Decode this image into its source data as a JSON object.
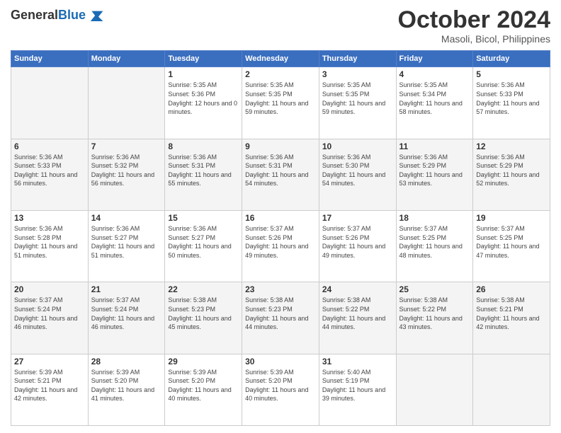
{
  "logo": {
    "general": "General",
    "blue": "Blue"
  },
  "header": {
    "month": "October 2024",
    "location": "Masoli, Bicol, Philippines"
  },
  "weekdays": [
    "Sunday",
    "Monday",
    "Tuesday",
    "Wednesday",
    "Thursday",
    "Friday",
    "Saturday"
  ],
  "weeks": [
    [
      {
        "day": "",
        "sunrise": "",
        "sunset": "",
        "daylight": ""
      },
      {
        "day": "",
        "sunrise": "",
        "sunset": "",
        "daylight": ""
      },
      {
        "day": "1",
        "sunrise": "Sunrise: 5:35 AM",
        "sunset": "Sunset: 5:36 PM",
        "daylight": "Daylight: 12 hours and 0 minutes."
      },
      {
        "day": "2",
        "sunrise": "Sunrise: 5:35 AM",
        "sunset": "Sunset: 5:35 PM",
        "daylight": "Daylight: 11 hours and 59 minutes."
      },
      {
        "day": "3",
        "sunrise": "Sunrise: 5:35 AM",
        "sunset": "Sunset: 5:35 PM",
        "daylight": "Daylight: 11 hours and 59 minutes."
      },
      {
        "day": "4",
        "sunrise": "Sunrise: 5:35 AM",
        "sunset": "Sunset: 5:34 PM",
        "daylight": "Daylight: 11 hours and 58 minutes."
      },
      {
        "day": "5",
        "sunrise": "Sunrise: 5:36 AM",
        "sunset": "Sunset: 5:33 PM",
        "daylight": "Daylight: 11 hours and 57 minutes."
      }
    ],
    [
      {
        "day": "6",
        "sunrise": "Sunrise: 5:36 AM",
        "sunset": "Sunset: 5:33 PM",
        "daylight": "Daylight: 11 hours and 56 minutes."
      },
      {
        "day": "7",
        "sunrise": "Sunrise: 5:36 AM",
        "sunset": "Sunset: 5:32 PM",
        "daylight": "Daylight: 11 hours and 56 minutes."
      },
      {
        "day": "8",
        "sunrise": "Sunrise: 5:36 AM",
        "sunset": "Sunset: 5:31 PM",
        "daylight": "Daylight: 11 hours and 55 minutes."
      },
      {
        "day": "9",
        "sunrise": "Sunrise: 5:36 AM",
        "sunset": "Sunset: 5:31 PM",
        "daylight": "Daylight: 11 hours and 54 minutes."
      },
      {
        "day": "10",
        "sunrise": "Sunrise: 5:36 AM",
        "sunset": "Sunset: 5:30 PM",
        "daylight": "Daylight: 11 hours and 54 minutes."
      },
      {
        "day": "11",
        "sunrise": "Sunrise: 5:36 AM",
        "sunset": "Sunset: 5:29 PM",
        "daylight": "Daylight: 11 hours and 53 minutes."
      },
      {
        "day": "12",
        "sunrise": "Sunrise: 5:36 AM",
        "sunset": "Sunset: 5:29 PM",
        "daylight": "Daylight: 11 hours and 52 minutes."
      }
    ],
    [
      {
        "day": "13",
        "sunrise": "Sunrise: 5:36 AM",
        "sunset": "Sunset: 5:28 PM",
        "daylight": "Daylight: 11 hours and 51 minutes."
      },
      {
        "day": "14",
        "sunrise": "Sunrise: 5:36 AM",
        "sunset": "Sunset: 5:27 PM",
        "daylight": "Daylight: 11 hours and 51 minutes."
      },
      {
        "day": "15",
        "sunrise": "Sunrise: 5:36 AM",
        "sunset": "Sunset: 5:27 PM",
        "daylight": "Daylight: 11 hours and 50 minutes."
      },
      {
        "day": "16",
        "sunrise": "Sunrise: 5:37 AM",
        "sunset": "Sunset: 5:26 PM",
        "daylight": "Daylight: 11 hours and 49 minutes."
      },
      {
        "day": "17",
        "sunrise": "Sunrise: 5:37 AM",
        "sunset": "Sunset: 5:26 PM",
        "daylight": "Daylight: 11 hours and 49 minutes."
      },
      {
        "day": "18",
        "sunrise": "Sunrise: 5:37 AM",
        "sunset": "Sunset: 5:25 PM",
        "daylight": "Daylight: 11 hours and 48 minutes."
      },
      {
        "day": "19",
        "sunrise": "Sunrise: 5:37 AM",
        "sunset": "Sunset: 5:25 PM",
        "daylight": "Daylight: 11 hours and 47 minutes."
      }
    ],
    [
      {
        "day": "20",
        "sunrise": "Sunrise: 5:37 AM",
        "sunset": "Sunset: 5:24 PM",
        "daylight": "Daylight: 11 hours and 46 minutes."
      },
      {
        "day": "21",
        "sunrise": "Sunrise: 5:37 AM",
        "sunset": "Sunset: 5:24 PM",
        "daylight": "Daylight: 11 hours and 46 minutes."
      },
      {
        "day": "22",
        "sunrise": "Sunrise: 5:38 AM",
        "sunset": "Sunset: 5:23 PM",
        "daylight": "Daylight: 11 hours and 45 minutes."
      },
      {
        "day": "23",
        "sunrise": "Sunrise: 5:38 AM",
        "sunset": "Sunset: 5:23 PM",
        "daylight": "Daylight: 11 hours and 44 minutes."
      },
      {
        "day": "24",
        "sunrise": "Sunrise: 5:38 AM",
        "sunset": "Sunset: 5:22 PM",
        "daylight": "Daylight: 11 hours and 44 minutes."
      },
      {
        "day": "25",
        "sunrise": "Sunrise: 5:38 AM",
        "sunset": "Sunset: 5:22 PM",
        "daylight": "Daylight: 11 hours and 43 minutes."
      },
      {
        "day": "26",
        "sunrise": "Sunrise: 5:38 AM",
        "sunset": "Sunset: 5:21 PM",
        "daylight": "Daylight: 11 hours and 42 minutes."
      }
    ],
    [
      {
        "day": "27",
        "sunrise": "Sunrise: 5:39 AM",
        "sunset": "Sunset: 5:21 PM",
        "daylight": "Daylight: 11 hours and 42 minutes."
      },
      {
        "day": "28",
        "sunrise": "Sunrise: 5:39 AM",
        "sunset": "Sunset: 5:20 PM",
        "daylight": "Daylight: 11 hours and 41 minutes."
      },
      {
        "day": "29",
        "sunrise": "Sunrise: 5:39 AM",
        "sunset": "Sunset: 5:20 PM",
        "daylight": "Daylight: 11 hours and 40 minutes."
      },
      {
        "day": "30",
        "sunrise": "Sunrise: 5:39 AM",
        "sunset": "Sunset: 5:20 PM",
        "daylight": "Daylight: 11 hours and 40 minutes."
      },
      {
        "day": "31",
        "sunrise": "Sunrise: 5:40 AM",
        "sunset": "Sunset: 5:19 PM",
        "daylight": "Daylight: 11 hours and 39 minutes."
      },
      {
        "day": "",
        "sunrise": "",
        "sunset": "",
        "daylight": ""
      },
      {
        "day": "",
        "sunrise": "",
        "sunset": "",
        "daylight": ""
      }
    ]
  ]
}
